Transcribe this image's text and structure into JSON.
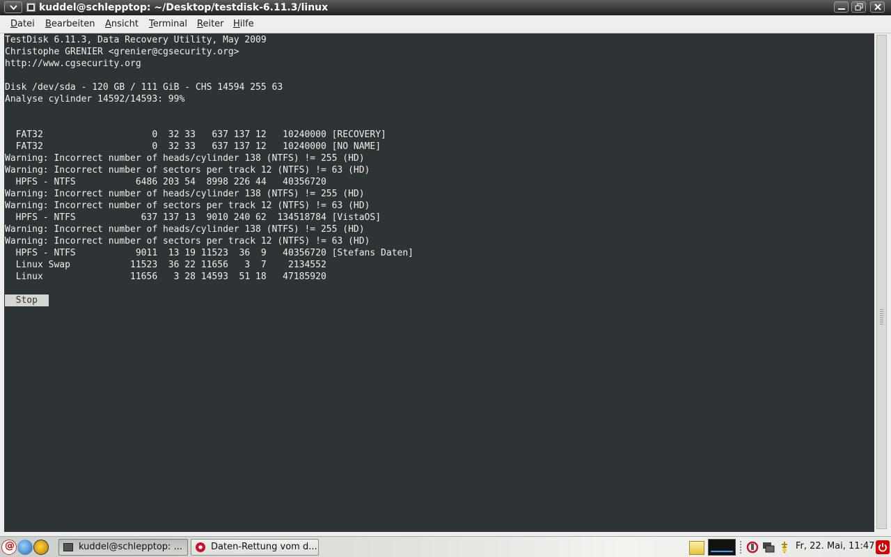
{
  "window": {
    "title": "kuddel@schlepptop: ~/Desktop/testdisk-6.11.3/linux"
  },
  "menu": {
    "items": [
      {
        "accel": "D",
        "rest": "atei"
      },
      {
        "accel": "B",
        "rest": "earbeiten"
      },
      {
        "accel": "A",
        "rest": "nsicht"
      },
      {
        "accel": "T",
        "rest": "erminal"
      },
      {
        "accel": "R",
        "rest": "eiter"
      },
      {
        "accel": "H",
        "rest": "ilfe"
      }
    ]
  },
  "terminal": {
    "lines": [
      "TestDisk 6.11.3, Data Recovery Utility, May 2009",
      "Christophe GRENIER <grenier@cgsecurity.org>",
      "http://www.cgsecurity.org",
      "",
      "Disk /dev/sda - 120 GB / 111 GiB - CHS 14594 255 63",
      "Analyse cylinder 14592/14593: 99%",
      "",
      "",
      "  FAT32                    0  32 33   637 137 12   10240000 [RECOVERY]",
      "  FAT32                    0  32 33   637 137 12   10240000 [NO NAME]",
      "Warning: Incorrect number of heads/cylinder 138 (NTFS) != 255 (HD)",
      "Warning: Incorrect number of sectors per track 12 (NTFS) != 63 (HD)",
      "  HPFS - NTFS           6486 203 54  8998 226 44   40356720",
      "Warning: Incorrect number of heads/cylinder 138 (NTFS) != 255 (HD)",
      "Warning: Incorrect number of sectors per track 12 (NTFS) != 63 (HD)",
      "  HPFS - NTFS            637 137 13  9010 240 62  134518784 [VistaOS]",
      "Warning: Incorrect number of heads/cylinder 138 (NTFS) != 255 (HD)",
      "Warning: Incorrect number of sectors per track 12 (NTFS) != 63 (HD)",
      "  HPFS - NTFS           9011  13 19 11523  36  9   40356720 [Stefans Daten]",
      "  Linux Swap           11523  36 22 11656   3  7    2134552",
      "  Linux                11656   3 28 14593  51 18   47185920",
      ""
    ],
    "stop_label": "  Stop  "
  },
  "taskbar": {
    "tasks": [
      {
        "label": "kuddel@schlepptop: ..."
      },
      {
        "label": "Daten-Rettung vom d..."
      }
    ],
    "clock": "Fr, 22. Mai, 11:47"
  },
  "icons": {
    "window_menu": "chevron-down-icon",
    "terminal_app": "terminal-icon",
    "minimize": "minimize-icon",
    "maximize": "maximize-icon",
    "close": "close-icon",
    "logout": "power-icon"
  }
}
